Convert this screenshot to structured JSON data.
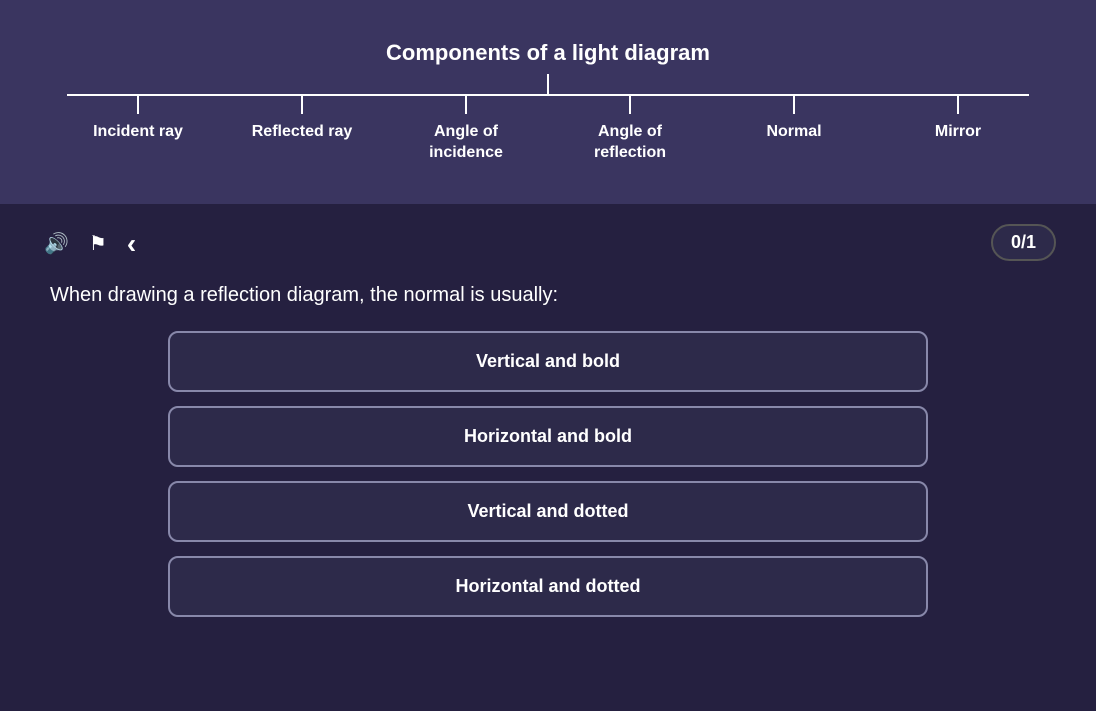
{
  "diagram": {
    "title": "Components of a light diagram",
    "branches": [
      {
        "id": "incident-ray",
        "label": "Incident ray"
      },
      {
        "id": "reflected-ray",
        "label": "Reflected ray"
      },
      {
        "id": "angle-incidence",
        "label": "Angle of\nincidence"
      },
      {
        "id": "angle-reflection",
        "label": "Angle of\nreflection"
      },
      {
        "id": "normal",
        "label": "Normal"
      },
      {
        "id": "mirror",
        "label": "Mirror"
      }
    ]
  },
  "toolbar": {
    "sound_icon": "🔊",
    "flag_icon": "⚑",
    "back_icon": "‹"
  },
  "quiz": {
    "question": "When drawing a reflection diagram, the normal is usually:",
    "score_current": "0",
    "score_total": "1",
    "score_separator": "/",
    "options": [
      {
        "id": "opt1",
        "label": "Vertical and bold"
      },
      {
        "id": "opt2",
        "label": "Horizontal and bold"
      },
      {
        "id": "opt3",
        "label": "Vertical and dotted"
      },
      {
        "id": "opt4",
        "label": "Horizontal and dotted"
      }
    ]
  }
}
